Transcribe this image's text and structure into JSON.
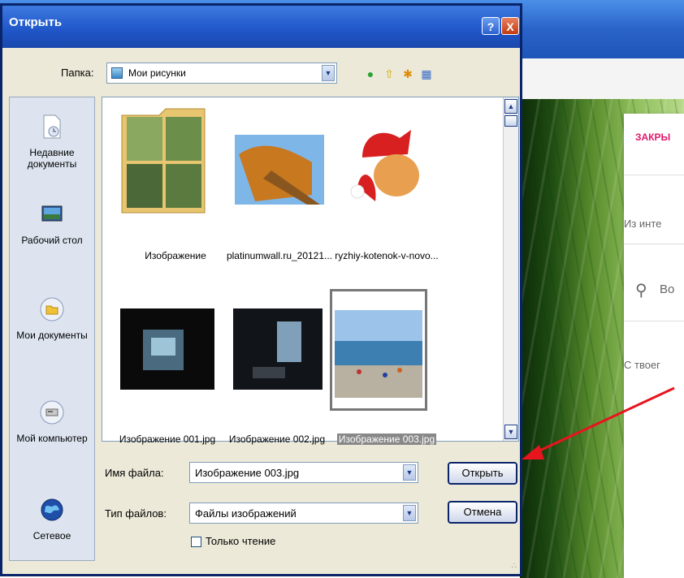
{
  "background": {
    "close_link": "ЗАКРЫ",
    "from_internet": "Из инте",
    "search_text": "Во",
    "from_your": "С твоег",
    "arrow_color": "#e8141e"
  },
  "dialog": {
    "title": "Открыть",
    "help_glyph": "?",
    "close_glyph": "X",
    "folder_label": "Папка:",
    "folder_value": "Мои рисунки",
    "places": [
      {
        "label": "Недавние документы",
        "icon": "recent-documents-icon"
      },
      {
        "label": "Рабочий стол",
        "icon": "desktop-icon"
      },
      {
        "label": "Мои документы",
        "icon": "my-documents-icon"
      },
      {
        "label": "Мой компьютер",
        "icon": "my-computer-icon"
      },
      {
        "label": "Сетевое",
        "icon": "network-icon"
      }
    ],
    "files": [
      {
        "name": "Изображение"
      },
      {
        "name": "platinumwall.ru_20121..."
      },
      {
        "name": "ryzhiy-kotenok-v-novo..."
      },
      {
        "name": "Изображение 001.jpg"
      },
      {
        "name": "Изображение 002.jpg"
      },
      {
        "name": "Изображение 003.jpg",
        "selected": true
      }
    ],
    "filename_label": "Имя файла:",
    "filename_value": "Изображение 003.jpg",
    "filetype_label": "Тип файлов:",
    "filetype_value": "Файлы изображений",
    "readonly_label": "Только чтение",
    "open_label": "Открыть",
    "cancel_label": "Отмена"
  }
}
